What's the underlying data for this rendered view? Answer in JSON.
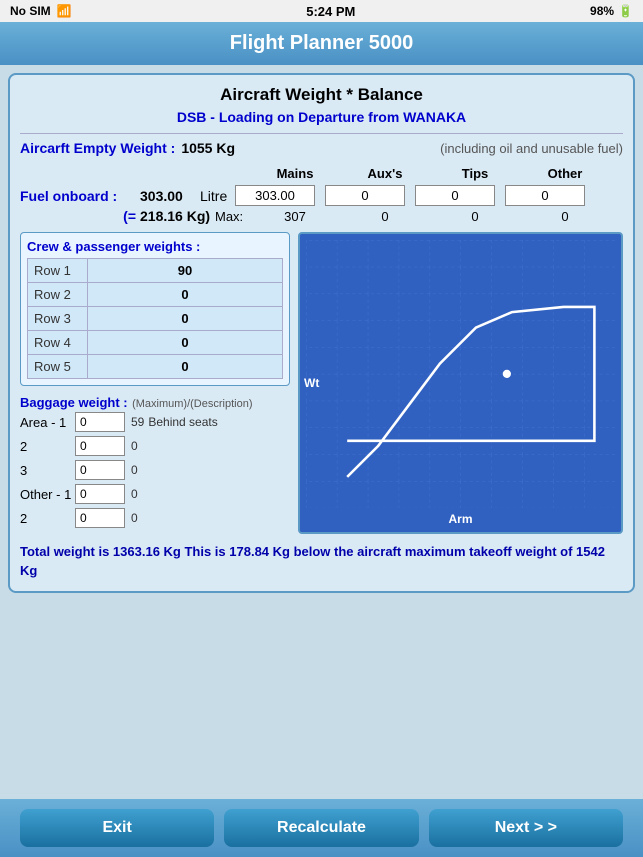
{
  "status_bar": {
    "carrier": "No SIM",
    "wifi": "📶",
    "time": "5:24 PM",
    "battery": "98%"
  },
  "title": "Flight Planner 5000",
  "card": {
    "heading": "Aircraft Weight * Balance",
    "subtitle": "DSB - Loading on Departure from WANAKA",
    "empty_weight_label": "Aircarft Empty Weight :",
    "empty_weight_value": "1055 Kg",
    "empty_weight_note": "(including oil and unusable fuel)"
  },
  "fuel": {
    "label": "Fuel onboard :",
    "value": "303.00",
    "unit": "Litre",
    "eq_label": "(=",
    "kg_value": "218.16 Kg)",
    "max_label": "Max:",
    "columns": [
      "Mains",
      "Aux's",
      "Tips",
      "Other"
    ],
    "inputs": [
      "303.00",
      "0",
      "0",
      "0"
    ],
    "max_values": [
      "307",
      "0",
      "0",
      "0"
    ]
  },
  "crew": {
    "title": "Crew & passenger weights :",
    "rows": [
      {
        "label": "Row 1",
        "value": "90"
      },
      {
        "label": "Row 2",
        "value": "0"
      },
      {
        "label": "Row 3",
        "value": "0"
      },
      {
        "label": "Row 4",
        "value": "0"
      },
      {
        "label": "Row 5",
        "value": "0"
      }
    ]
  },
  "baggage": {
    "title": "Baggage weight :",
    "sub": "(Maximum)/(Description)",
    "areas": [
      {
        "label": "Area - 1",
        "input": "0",
        "max": "59",
        "desc": "Behind seats"
      },
      {
        "label": "2",
        "input": "0",
        "max": "0",
        "desc": ""
      },
      {
        "label": "3",
        "input": "0",
        "max": "0",
        "desc": ""
      },
      {
        "label": "Other - 1",
        "input": "0",
        "max": "0",
        "desc": ""
      },
      {
        "label": "2",
        "input": "0",
        "max": "0",
        "desc": ""
      }
    ]
  },
  "chart": {
    "wt_label": "Wt",
    "arm_label": "Arm"
  },
  "total_weight": {
    "text": "Total weight is 1363.16 Kg This is  178.84 Kg below the aircraft maximum takeoff weight of 1542 Kg"
  },
  "buttons": {
    "exit": "Exit",
    "recalculate": "Recalculate",
    "next": "Next > >"
  }
}
